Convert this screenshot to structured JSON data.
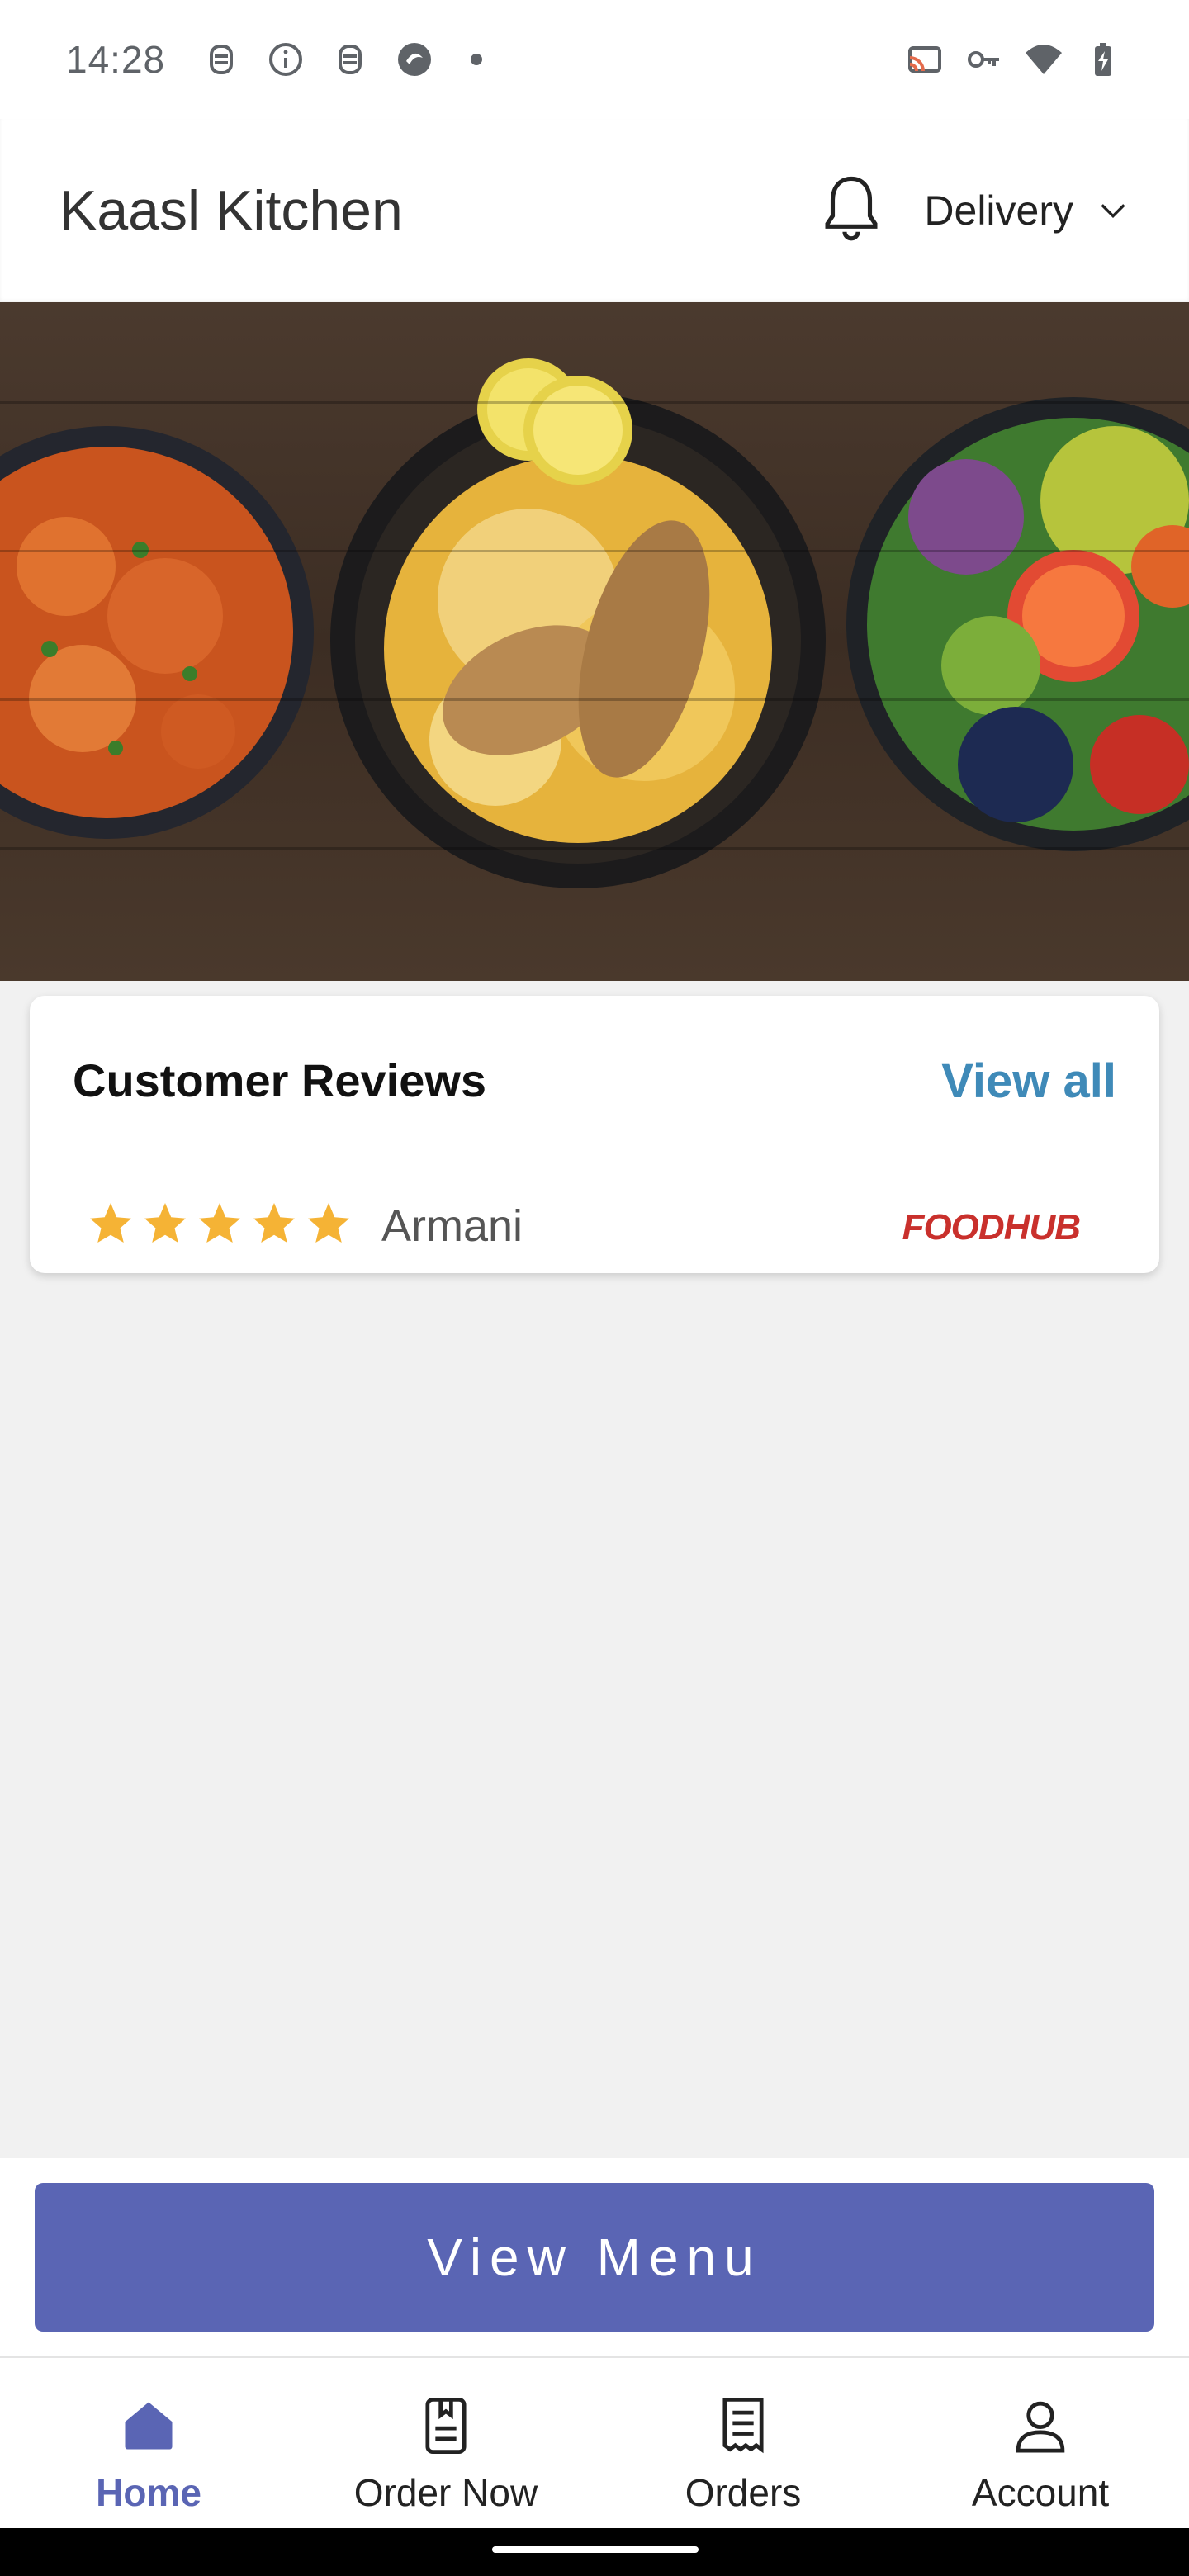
{
  "status_bar": {
    "time": "14:28",
    "left_icons": [
      "notification-icon",
      "info-icon",
      "notification-icon",
      "app-icon",
      "dot-icon"
    ],
    "right_icons": [
      "cast-icon",
      "vpn-key-icon",
      "wifi-icon",
      "battery-icon"
    ]
  },
  "app_bar": {
    "title": "Kaasl Kitchen",
    "notification_icon": "bell-icon",
    "mode_label": "Delivery",
    "mode_icon": "chevron-down-icon"
  },
  "hero": {
    "description_icon": "food-banner-image"
  },
  "reviews": {
    "title": "Customer Reviews",
    "view_all": "View all",
    "items": [
      {
        "stars": 5,
        "reviewer": "Armani",
        "source": "FOODHUB"
      }
    ]
  },
  "menu_button": {
    "label": "View Menu"
  },
  "bottom_nav": {
    "items": [
      {
        "label": "Home",
        "icon": "home-icon",
        "active": true
      },
      {
        "label": "Order Now",
        "icon": "menu-book-icon",
        "active": false
      },
      {
        "label": "Orders",
        "icon": "receipt-icon",
        "active": false
      },
      {
        "label": "Account",
        "icon": "user-icon",
        "active": false
      }
    ]
  },
  "colors": {
    "accent": "#5a65b4",
    "link": "#3f8ab8",
    "star": "#f5b335",
    "brand_red": "#c9302c"
  }
}
